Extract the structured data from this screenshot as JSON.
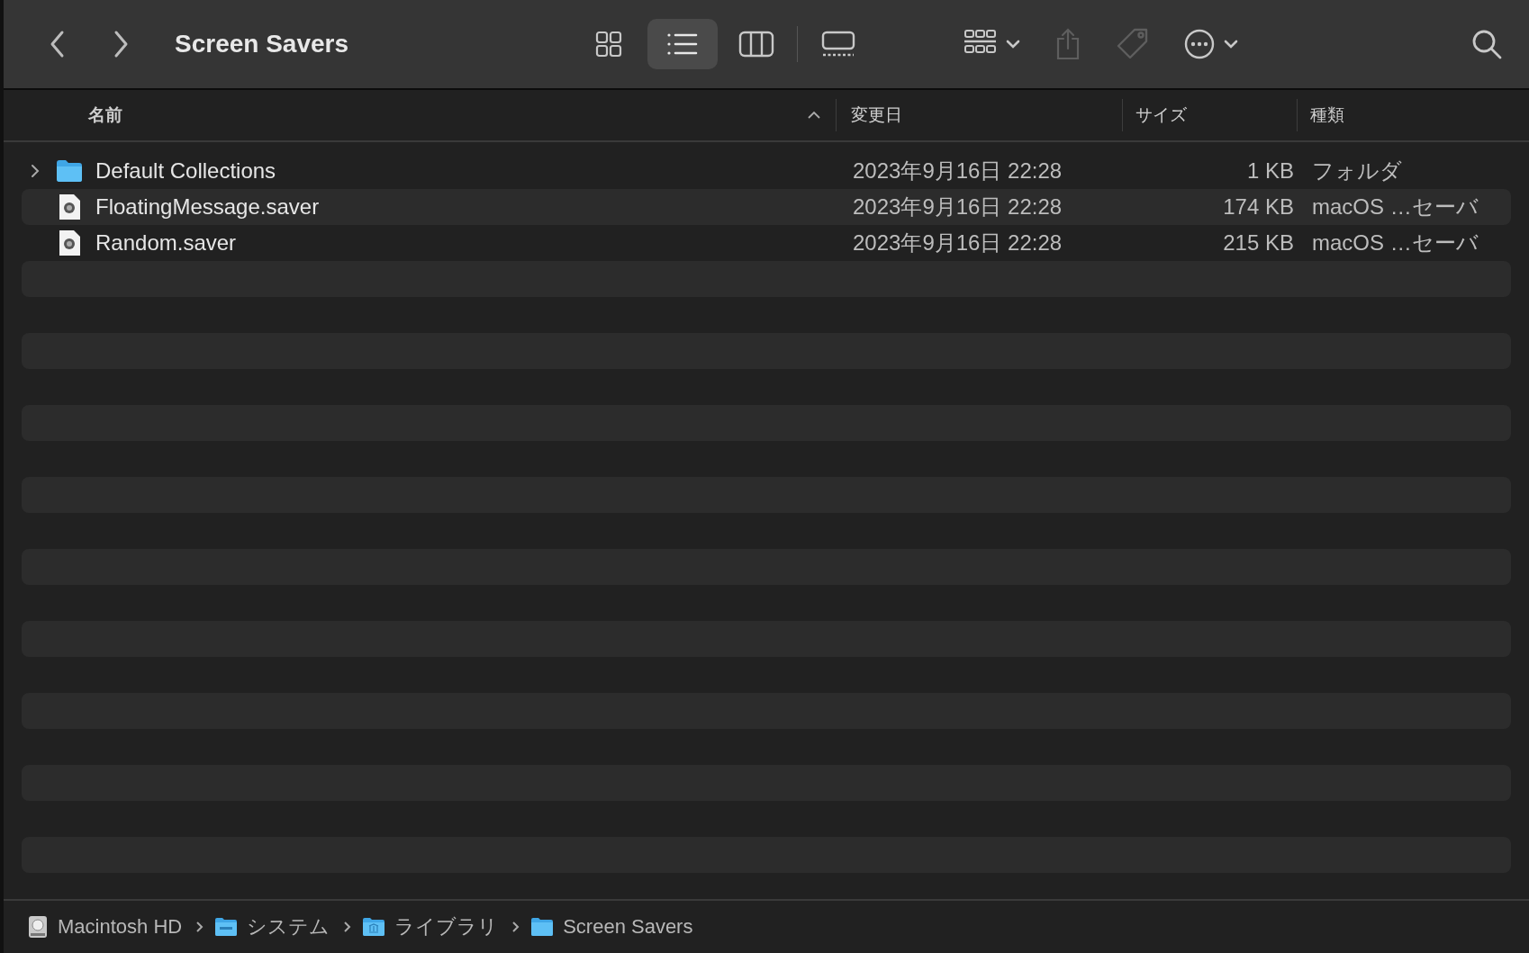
{
  "window": {
    "title": "Screen Savers"
  },
  "view_buttons": [
    {
      "kind": "icons",
      "selected": false
    },
    {
      "kind": "list",
      "selected": true
    },
    {
      "kind": "columns",
      "selected": false
    },
    {
      "kind": "gallery",
      "selected": false
    }
  ],
  "toolbar_buttons": [
    {
      "kind": "group",
      "disabled": false
    },
    {
      "kind": "share",
      "disabled": true
    },
    {
      "kind": "tag",
      "disabled": true
    },
    {
      "kind": "more",
      "disabled": false
    }
  ],
  "table": {
    "columns": [
      {
        "label": "名前",
        "sorted": true
      },
      {
        "label": "変更日",
        "sorted": false
      },
      {
        "label": "サイズ",
        "sorted": false
      },
      {
        "label": "種類",
        "sorted": false
      }
    ],
    "rows": [
      {
        "kind": "folder",
        "expanded": false,
        "name": "Default Collections",
        "modified": "2023年9月16日 22:28",
        "size": "1 KB",
        "type": "フォルダ"
      },
      {
        "kind": "saver",
        "name": "FloatingMessage.saver",
        "modified": "2023年9月16日 22:28",
        "size": "174 KB",
        "type": "macOS …セーバ"
      },
      {
        "kind": "saver",
        "name": "Random.saver",
        "modified": "2023年9月16日 22:28",
        "size": "215 KB",
        "type": "macOS …セーバ"
      }
    ]
  },
  "path_bar": [
    {
      "kind": "disk",
      "label": "Macintosh HD"
    },
    {
      "kind": "system",
      "label": "システム"
    },
    {
      "kind": "library",
      "label": "ライブラリ"
    },
    {
      "kind": "folder",
      "label": "Screen Savers"
    }
  ]
}
